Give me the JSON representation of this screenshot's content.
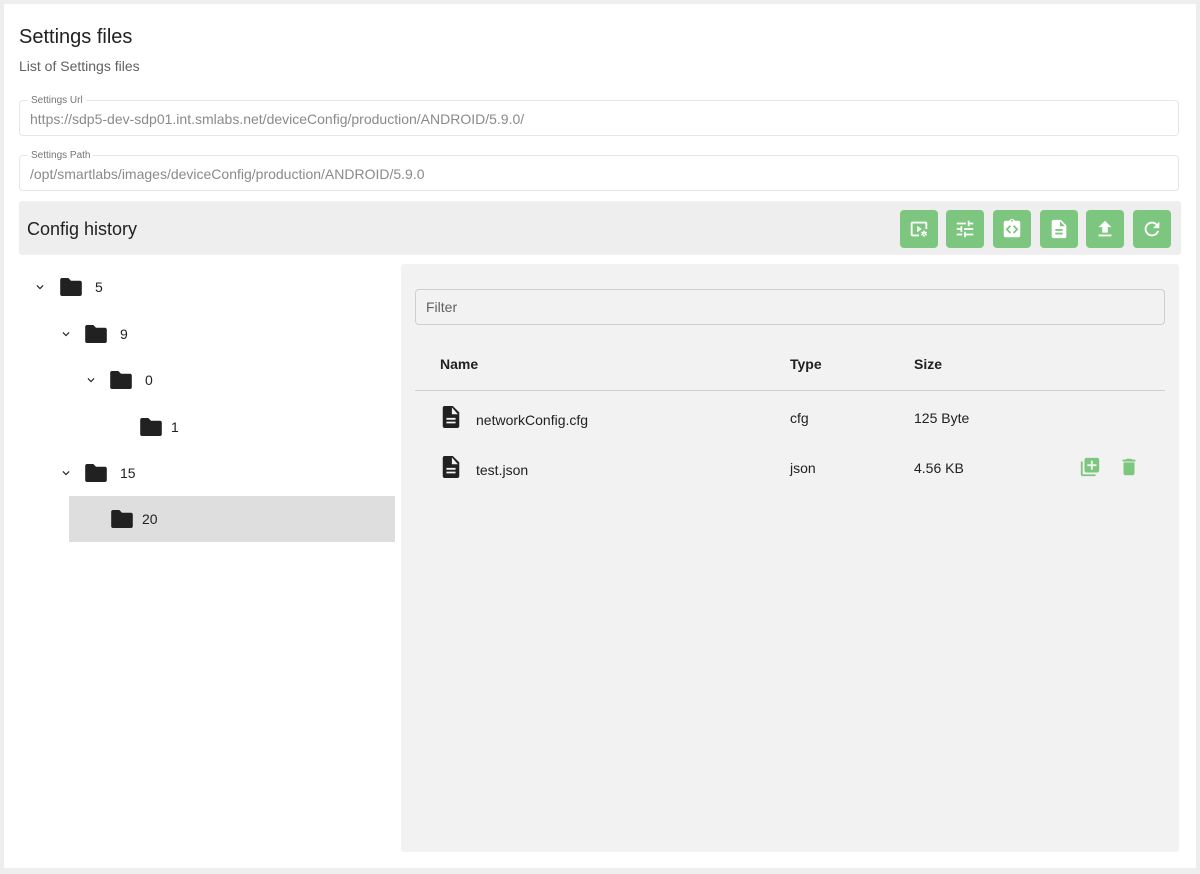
{
  "header": {
    "title": "Settings files",
    "subtitle": "List of Settings files"
  },
  "fields": {
    "url": {
      "label": "Settings Url",
      "value": "https://sdp5-dev-sdp01.int.smlabs.net/deviceConfig/production/ANDROID/5.9.0/"
    },
    "path": {
      "label": "Settings Path",
      "value": "/opt/smartlabs/images/deviceConfig/production/ANDROID/5.9.0"
    }
  },
  "history": {
    "title": "Config history",
    "toolbar": [
      "video-settings-icon",
      "tune-icon",
      "code-clipboard-icon",
      "document-icon",
      "upload-icon",
      "refresh-icon"
    ],
    "accent_color": "#7dc67f"
  },
  "tree": [
    {
      "label": "5",
      "expanded": true
    },
    {
      "label": "9",
      "expanded": true
    },
    {
      "label": "0",
      "expanded": true
    },
    {
      "label": "1",
      "expanded": false
    },
    {
      "label": "15",
      "expanded": true
    },
    {
      "label": "20",
      "expanded": false,
      "selected": true
    }
  ],
  "files": {
    "filter_placeholder": "Filter",
    "columns": [
      "Name",
      "Type",
      "Size"
    ],
    "rows": [
      {
        "name": "networkConfig.cfg",
        "type": "cfg",
        "size": "125 Byte"
      },
      {
        "name": "test.json",
        "type": "json",
        "size": "4.56 KB",
        "actions": [
          "copy-file-icon",
          "delete-icon"
        ]
      }
    ]
  }
}
